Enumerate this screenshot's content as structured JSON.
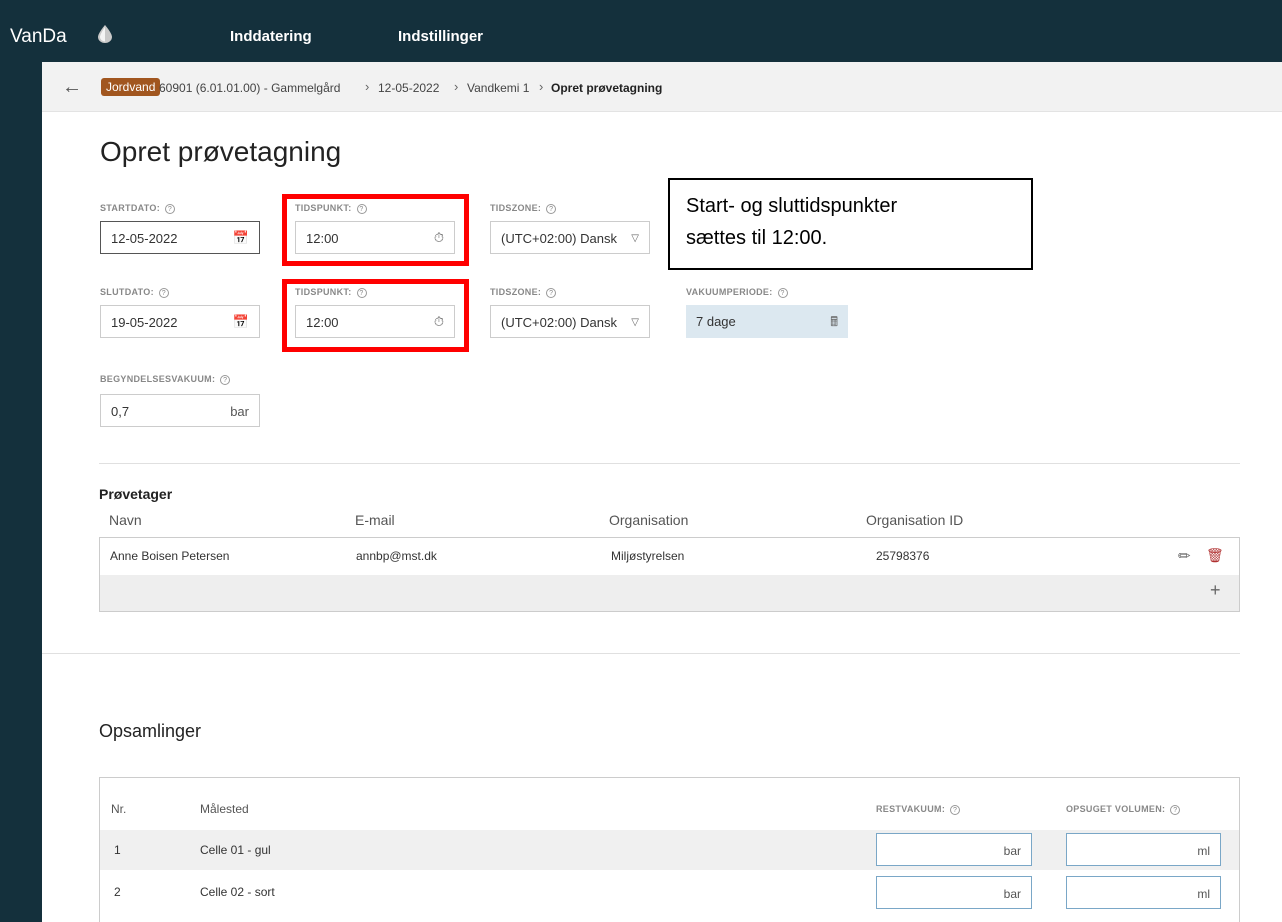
{
  "app": {
    "name": "VanDa"
  },
  "nav": {
    "item1": "Inddatering",
    "item2": "Indstillinger"
  },
  "breadcrumb": {
    "tag": "Jordvand",
    "station": "60901 (6.01.01.00) - Gammelgård",
    "date": "12-05-2022",
    "measurement": "Vandkemi 1",
    "current": "Opret prøvetagning"
  },
  "page": {
    "title": "Opret prøvetagning"
  },
  "form": {
    "start_date_label": "STARTDATO:",
    "start_date": "12-05-2022",
    "start_time_label": "TIDSPUNKT:",
    "start_time": "12:00",
    "start_tz_label": "TIDSZONE:",
    "start_tz": "(UTC+02:00) Dansk",
    "end_date_label": "SLUTDATO:",
    "end_date": "19-05-2022",
    "end_time_label": "TIDSPUNKT:",
    "end_time": "12:00",
    "end_tz_label": "TIDSZONE:",
    "end_tz": "(UTC+02:00) Dansk",
    "vacuum_period_label": "VAKUUMPERIODE:",
    "vacuum_period": "7 dage",
    "initial_vacuum_label": "BEGYNDELSESVAKUUM:",
    "initial_vacuum": "0,7",
    "initial_vacuum_unit": "bar"
  },
  "annotation": {
    "line1": "Start- og sluttidspunkter",
    "line2": "sættes til 12:00."
  },
  "samplers": {
    "title": "Prøvetager",
    "columns": [
      "Navn",
      "E-mail",
      "Organisation",
      "Organisation ID"
    ],
    "rows": [
      {
        "name": "Anne Boisen Petersen",
        "email": "annbp@mst.dk",
        "org": "Miljøstyrelsen",
        "org_id": "25798376"
      }
    ],
    "add": "+"
  },
  "collections": {
    "title": "Opsamlinger",
    "col_nr": "Nr.",
    "col_place": "Målested",
    "col_rest": "RESTVAKUUM:",
    "col_volume": "OPSUGET VOLUMEN:",
    "rows": [
      {
        "nr": "1",
        "place": "Celle 01 - gul",
        "rest_unit": "bar",
        "vol_unit": "ml"
      },
      {
        "nr": "2",
        "place": "Celle 02 - sort",
        "rest_unit": "bar",
        "vol_unit": "ml"
      }
    ]
  },
  "icons": {
    "calendar": "calendar-icon",
    "clock": "stopwatch-icon",
    "dropdown": "triangle-down-icon",
    "calculator": "calculator-icon",
    "back": "arrow-left-icon",
    "edit": "pencil-icon",
    "delete": "trash-icon",
    "add": "plus-icon",
    "help": "help-icon",
    "logo": "water-drop-icon"
  },
  "colors": {
    "header": "#14303c",
    "tag": "#a1561f",
    "highlight": "#ff0000"
  }
}
